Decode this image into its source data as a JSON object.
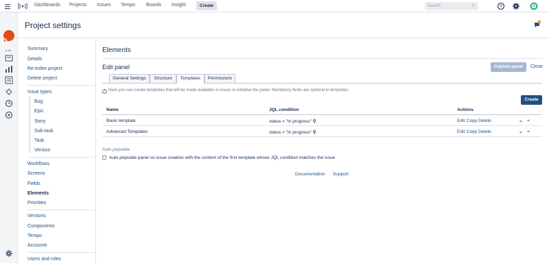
{
  "topnav": {
    "items": [
      "Dashboards",
      "Projects",
      "Issues",
      "Tempo",
      "Boards",
      "Insight"
    ],
    "create_label": "Create",
    "search_placeholder": "Search",
    "icons": [
      "app-switcher-icon",
      "help-icon",
      "gear-icon",
      "user-avatar-icon"
    ]
  },
  "header": {
    "title": "Project settings"
  },
  "sidebar": {
    "group1": [
      "Summary",
      "Details",
      "Re-index project",
      "Delete project"
    ],
    "issue_types_label": "Issue types",
    "issue_types": [
      "Bug",
      "Epic",
      "Story",
      "Sub-task",
      "Task",
      "Version"
    ],
    "group3": [
      "Workflows",
      "Screens",
      "Fields",
      "Elements",
      "Priorities"
    ],
    "group4": [
      "Versions",
      "Components",
      "Tempo",
      "Accounts"
    ],
    "group5": [
      "Users and roles"
    ],
    "active": "Elements"
  },
  "main": {
    "section_title": "Elements",
    "panel_title": "Edit panel",
    "publish_label": "Publish panel",
    "close_label": "Close",
    "tabs": [
      "General Settings",
      "Structure",
      "Templates",
      "Permissions"
    ],
    "active_tab": "Templates",
    "info_text": "Here you can create templates that will be made available in issues to initialise the panel. Mandatory fields are optional in templates.",
    "create_label": "Create",
    "table": {
      "headers": [
        "Name",
        "JQL condition",
        "Actions"
      ],
      "rows": [
        {
          "name": "Basic template",
          "jql": "status = \"In progress\"",
          "actions": [
            "Edit",
            "Copy",
            "Delete"
          ]
        },
        {
          "name": "Advanced Templates",
          "jql": "status = \"In progress\"",
          "actions": [
            "Edit",
            "Copy",
            "Delete"
          ]
        }
      ]
    },
    "auto_populate": {
      "title": "Auto populate",
      "label": "Auto populate panel on issue creation with the content of the first template whose JQL condition matches the issue",
      "checked": false
    },
    "footer": [
      "Documentation",
      "Support"
    ]
  },
  "colors": {
    "link": "#205081",
    "primary_button": "#205081",
    "disabled_button": "#a5b6d1"
  }
}
